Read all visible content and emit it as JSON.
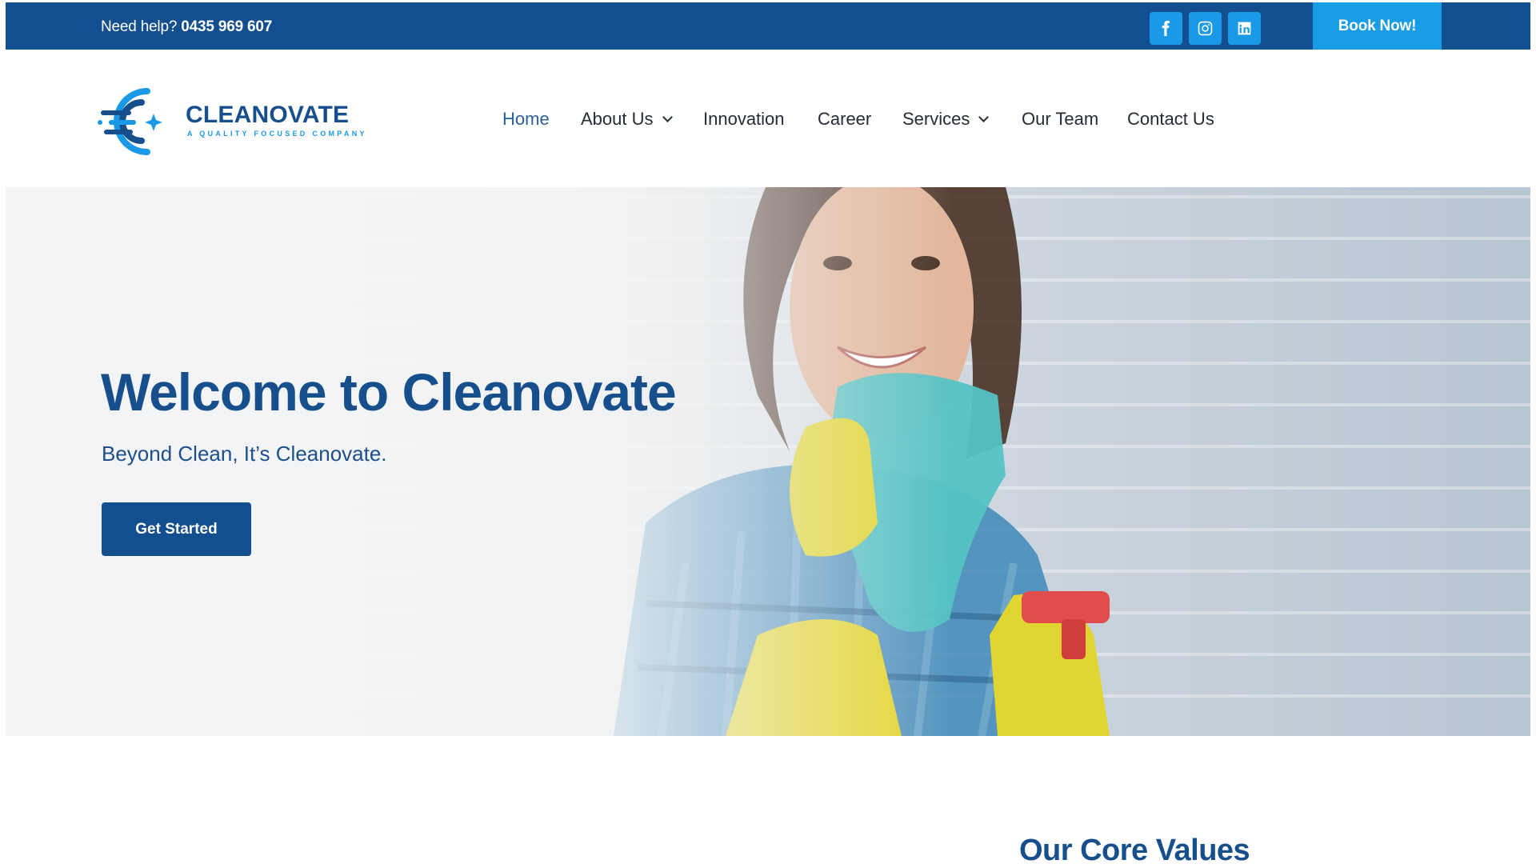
{
  "topbar": {
    "help_label": "Need help?",
    "phone": "0435 969 607",
    "social": [
      "facebook-icon",
      "instagram-icon",
      "linkedin-icon"
    ],
    "book_label": "Book Now!",
    "colors": {
      "bar": "#134f8f",
      "accent": "#1a9be6"
    }
  },
  "header": {
    "logo_word": "CLEANOVATE",
    "logo_tagline": "A QUALITY FOCUSED COMPANY",
    "nav": [
      {
        "label": "Home",
        "active": true
      },
      {
        "label": "About Us",
        "dropdown": true
      },
      {
        "label": "Innovation"
      },
      {
        "label": "Career"
      },
      {
        "label": "Services",
        "dropdown": true
      },
      {
        "label": "Our Team"
      },
      {
        "label": "Contact Us"
      }
    ]
  },
  "hero": {
    "title": "Welcome to Cleanovate",
    "subtitle": "Beyond Clean, It’s Cleanovate.",
    "cta_label": "Get Started"
  },
  "sections": {
    "core_values_title": "Our Core Values"
  }
}
